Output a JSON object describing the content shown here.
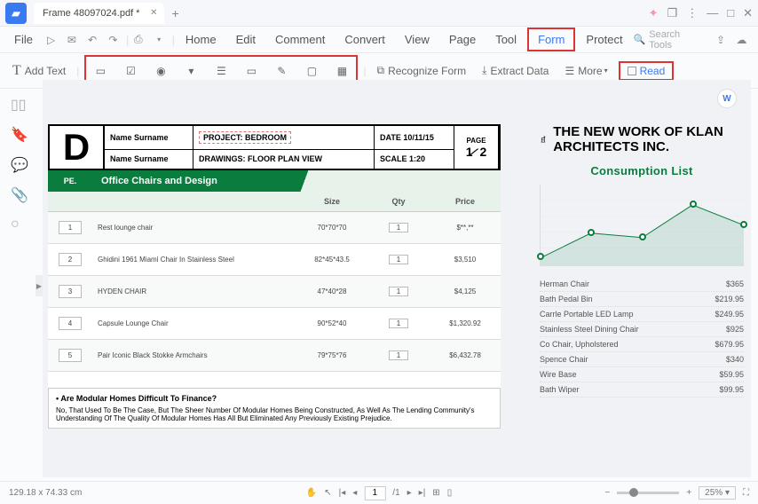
{
  "titlebar": {
    "filename": "Frame 48097024.pdf *"
  },
  "menubar": {
    "file": "File",
    "items": [
      "Home",
      "Edit",
      "Comment",
      "Convert",
      "View",
      "Page",
      "Tool",
      "Form",
      "Protect"
    ],
    "search_placeholder": "Search Tools"
  },
  "toolbar": {
    "add_text": "Add Text",
    "recognize": "Recognize Form",
    "extract": "Extract Data",
    "more": "More",
    "read": "Read"
  },
  "doc_header": {
    "name1": "Name Surname",
    "name2": "Name Surname",
    "project": "PROJECT: BEDROOM",
    "drawings": "DRAWINGS: FLOOR PLAN VIEW",
    "date": "DATE 10/11/15",
    "scale": "SCALE 1:20",
    "page_label": "PAGE",
    "page_frac": "1⁄2"
  },
  "table": {
    "header_pe": "PE.",
    "header_title": "Office Chairs and Design",
    "sub_size": "Size",
    "sub_qty": "Qty",
    "sub_price": "Price",
    "rows": [
      {
        "pe": "1",
        "name": "Rest lounge chair",
        "size": "70*70*70",
        "qty": "1",
        "price": "$**,**"
      },
      {
        "pe": "2",
        "name": "Ghidini 1961 Miami Chair In Stainless Steel",
        "size": "82*45*43.5",
        "qty": "1",
        "price": "$3,510"
      },
      {
        "pe": "3",
        "name": "HYDEN CHAIR",
        "size": "47*40*28",
        "qty": "1",
        "price": "$4,125"
      },
      {
        "pe": "4",
        "name": "Capsule Lounge Chair",
        "size": "90*52*40",
        "qty": "1",
        "price": "$1,320.92"
      },
      {
        "pe": "5",
        "name": "Pair Iconic Black Stokke Armchairs",
        "size": "79*75*76",
        "qty": "1",
        "price": "$6,432.78"
      }
    ]
  },
  "faq": {
    "question": "• Are Modular Homes Difficult To Finance?",
    "answer": "No, That Used To Be The Case, But The Sheer Number Of Modular Homes Being Constructed, As Well As The Lending Community's Understanding Of The Quality Of Modular Homes Has All But Eliminated Any Previously Existing Prejudice."
  },
  "right": {
    "company": "THE NEW WORK OF KLAN ARCHITECTS INC.",
    "consumption": "Consumption List",
    "prices": [
      {
        "name": "Herman Chair",
        "price": "$365"
      },
      {
        "name": "Bath Pedal Bin",
        "price": "$219.95"
      },
      {
        "name": "Carrle Portable LED Lamp",
        "price": "$249.95"
      },
      {
        "name": "Stainless Steel Dining Chair",
        "price": "$925"
      },
      {
        "name": "Co Chair, Upholstered",
        "price": "$679.95"
      },
      {
        "name": "Spence Chair",
        "price": "$340"
      },
      {
        "name": "Wire Base",
        "price": "$59.95"
      },
      {
        "name": "Bath Wiper",
        "price": "$99.95"
      }
    ]
  },
  "chart_data": {
    "type": "line",
    "title": "Consumption List",
    "x": [
      1,
      2,
      3,
      4,
      5
    ],
    "values": [
      10,
      40,
      35,
      75,
      50
    ],
    "ylim": [
      0,
      100
    ]
  },
  "status": {
    "coords": "129.18 x 74.33 cm",
    "page_current": "1",
    "page_total": "/1",
    "zoom": "25%"
  }
}
